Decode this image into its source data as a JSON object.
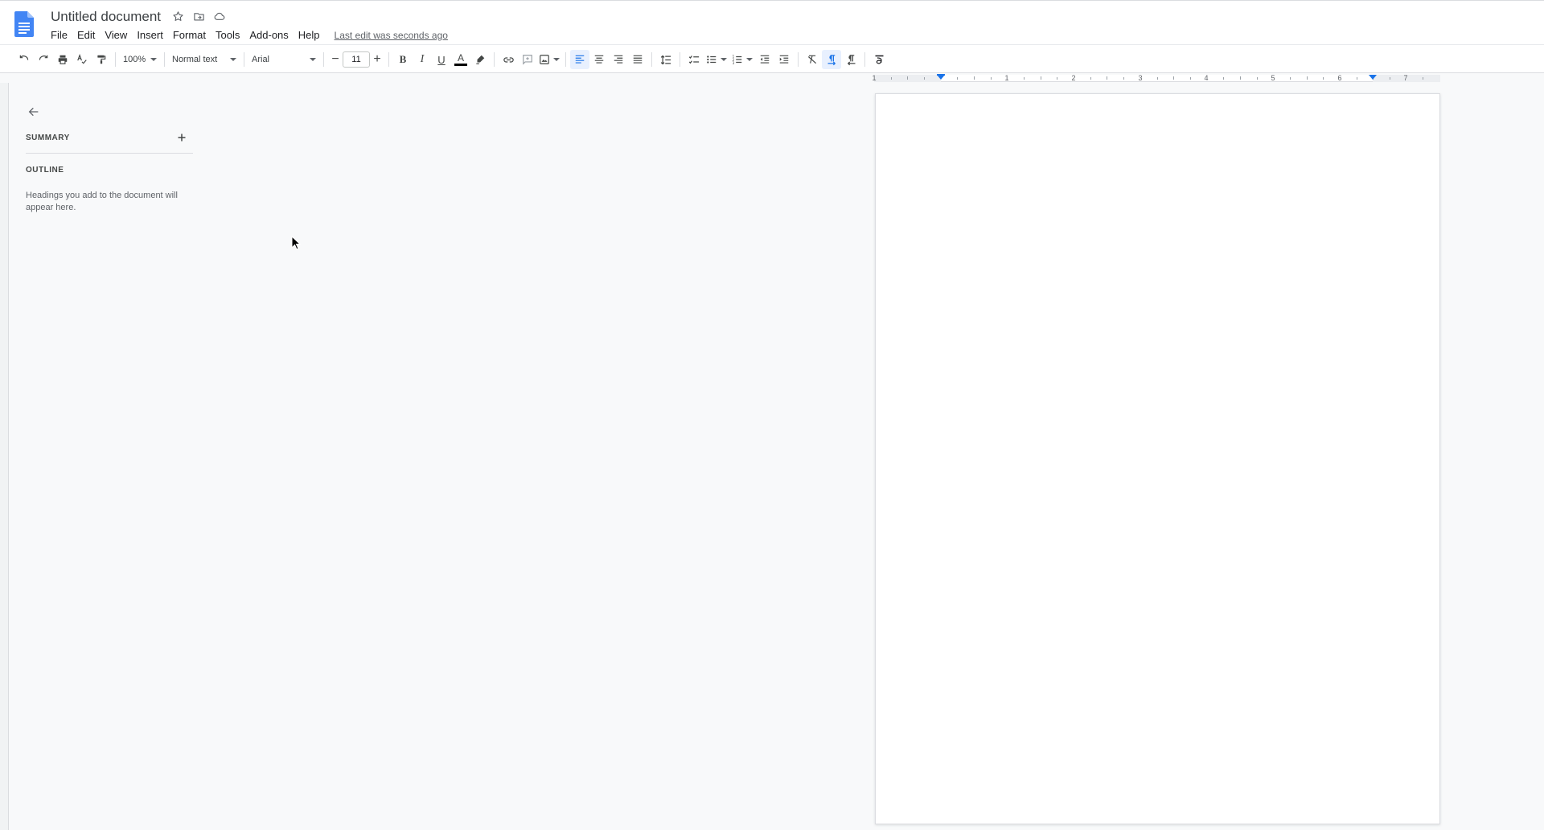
{
  "title_bar": {
    "doc_title": "Untitled document",
    "icons": [
      "star-icon",
      "move-to-folder-icon",
      "cloud-status-icon"
    ]
  },
  "menu": {
    "items": [
      "File",
      "Edit",
      "View",
      "Insert",
      "Format",
      "Tools",
      "Add-ons",
      "Help"
    ],
    "last_edit": "Last edit was seconds ago"
  },
  "toolbar": {
    "zoom": "100%",
    "style": "Normal text",
    "font": "Arial",
    "font_size": "11",
    "minus": "−",
    "plus": "+",
    "bold": "B",
    "italic": "I",
    "underline": "U",
    "text_color_glyph": "A",
    "text_color": "#000000"
  },
  "ruler": {
    "numbers": [
      "1",
      "1",
      "2",
      "3",
      "4",
      "5",
      "6",
      "7"
    ],
    "accent_color": "#1a73e8"
  },
  "outline_panel": {
    "summary_label": "SUMMARY",
    "outline_label": "OUTLINE",
    "hint": "Headings you add to the document will appear here."
  },
  "colors": {
    "brand_blue": "#4285f4",
    "background": "#f8f9fa"
  }
}
